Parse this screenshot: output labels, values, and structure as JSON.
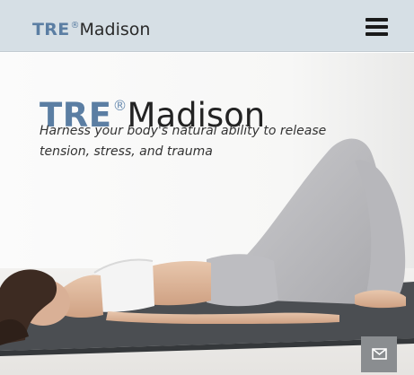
{
  "header": {
    "logo": {
      "tre": "TRE",
      "reg": "®",
      "madison": "Madison"
    },
    "menu_icon": "hamburger-menu-icon"
  },
  "hero": {
    "logo": {
      "tre": "TRE",
      "reg": "®",
      "madison": "Madison"
    },
    "tagline": "Harness your body's natural ability to release tension, stress, and trauma",
    "image": "woman-lying-on-yoga-mat"
  },
  "contact_button": {
    "icon": "envelope-icon"
  },
  "colors": {
    "header_bg": "#d6dfe5",
    "brand_blue": "#5b7ea3",
    "text_dark": "#232323",
    "button_gray": "#8a8d90"
  }
}
